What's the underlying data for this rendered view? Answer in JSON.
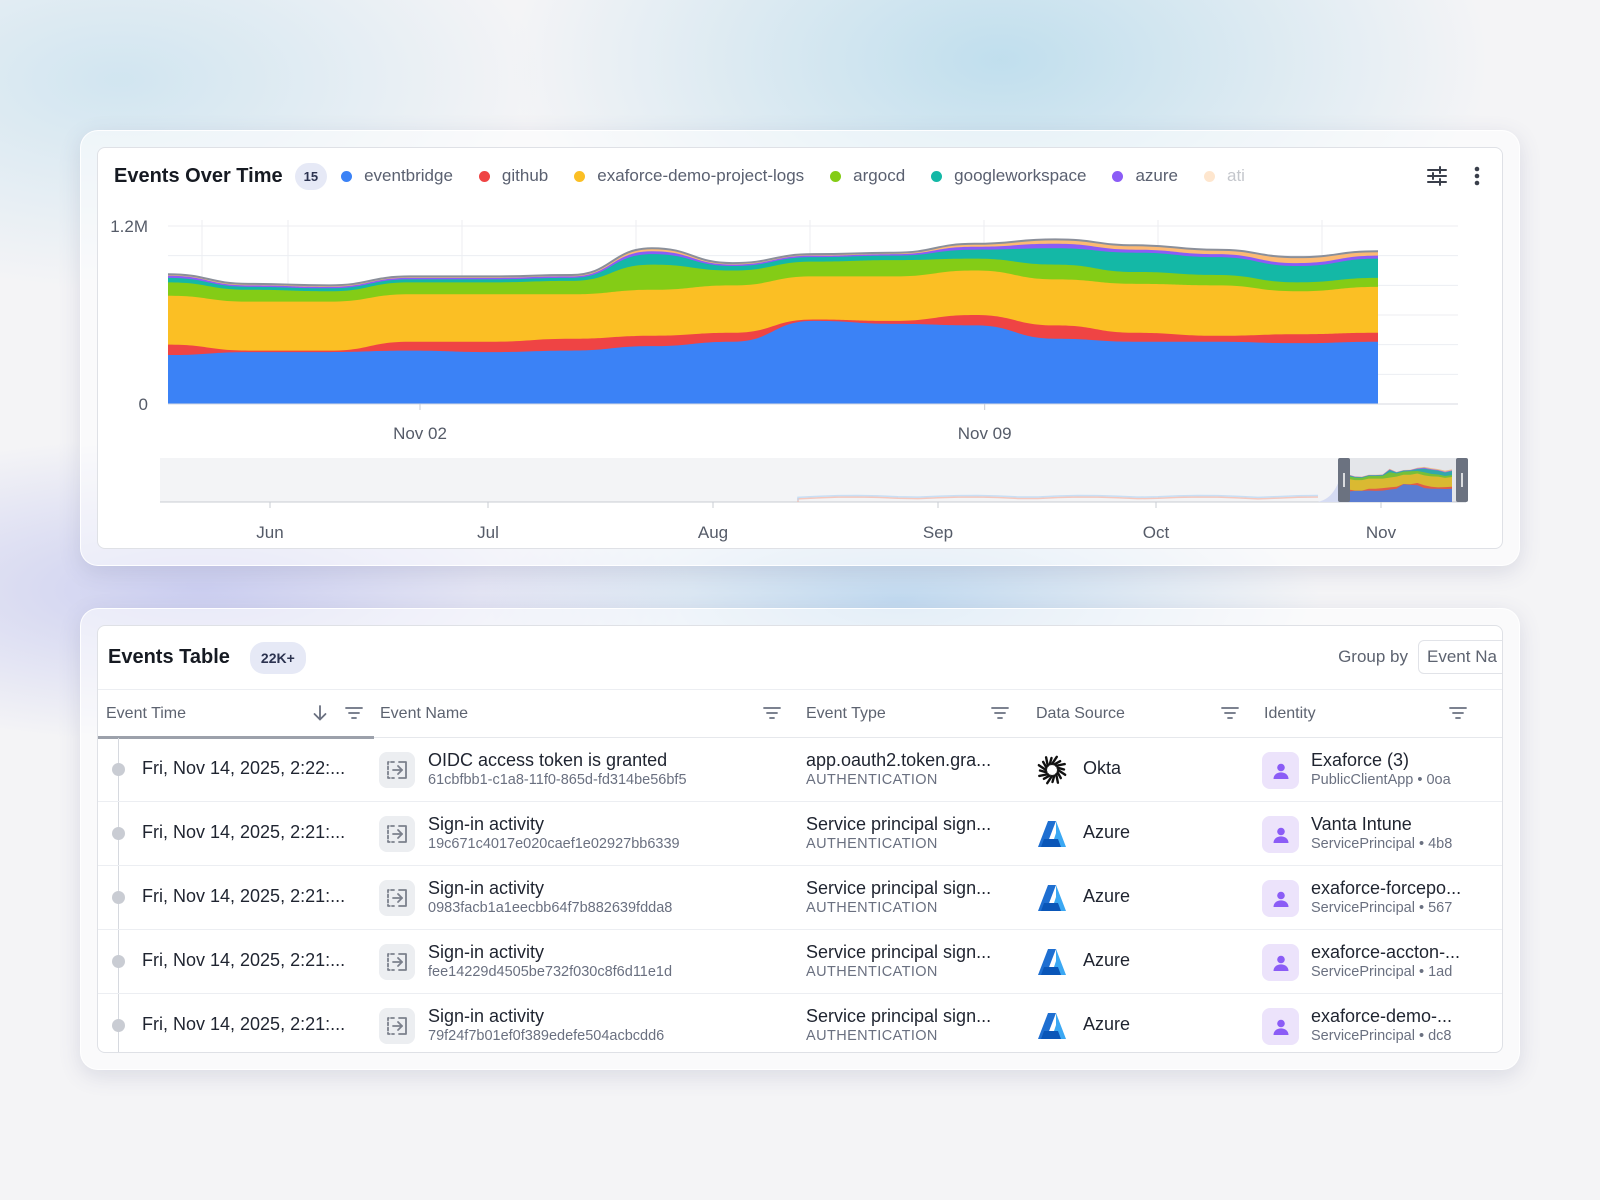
{
  "chart_card": {
    "title": "Events Over Time",
    "count_badge": "15",
    "legend": [
      {
        "label": "eventbridge",
        "color": "#3b82f6"
      },
      {
        "label": "github",
        "color": "#ef4444"
      },
      {
        "label": "exaforce-demo-project-logs",
        "color": "#fbbf24"
      },
      {
        "label": "argocd",
        "color": "#84cc16"
      },
      {
        "label": "googleworkspace",
        "color": "#14b8a6"
      },
      {
        "label": "azure",
        "color": "#8b5cf6"
      },
      {
        "label": "ati",
        "color": "#fdba74"
      }
    ],
    "icons": {
      "settings": "sliders-icon",
      "menu": "more-vertical-icon"
    }
  },
  "chart_data": [
    {
      "type": "area",
      "stacked": true,
      "title": "",
      "ylim": [
        0,
        1200000
      ],
      "y_tick_labels": [
        "0",
        "1.2M"
      ],
      "x_tick_labels": [
        "Nov 02",
        "Nov 09"
      ],
      "x": [
        "Oct 30",
        "Oct 31",
        "Nov 01",
        "Nov 02",
        "Nov 03",
        "Nov 04",
        "Nov 05",
        "Nov 06",
        "Nov 07",
        "Nov 08",
        "Nov 09",
        "Nov 10",
        "Nov 11",
        "Nov 12",
        "Nov 13",
        "Nov 14"
      ],
      "series": [
        {
          "name": "eventbridge",
          "color": "#3b82f6",
          "values": [
            330000,
            350000,
            350000,
            360000,
            350000,
            360000,
            390000,
            420000,
            560000,
            540000,
            530000,
            440000,
            420000,
            420000,
            410000,
            420000
          ]
        },
        {
          "name": "github",
          "color": "#ef4444",
          "values": [
            70000,
            10000,
            10000,
            60000,
            70000,
            80000,
            70000,
            60000,
            10000,
            20000,
            70000,
            90000,
            60000,
            40000,
            60000,
            60000
          ]
        },
        {
          "name": "exaforce-demo-project-logs",
          "color": "#fbbf24",
          "values": [
            330000,
            330000,
            330000,
            320000,
            320000,
            300000,
            310000,
            320000,
            290000,
            300000,
            300000,
            310000,
            330000,
            340000,
            290000,
            310000
          ]
        },
        {
          "name": "argocd",
          "color": "#84cc16",
          "values": [
            90000,
            80000,
            70000,
            80000,
            80000,
            90000,
            170000,
            100000,
            100000,
            110000,
            80000,
            100000,
            80000,
            70000,
            60000,
            60000
          ]
        },
        {
          "name": "googleworkspace",
          "color": "#14b8a6",
          "values": [
            30000,
            20000,
            20000,
            20000,
            20000,
            20000,
            70000,
            30000,
            30000,
            30000,
            60000,
            110000,
            130000,
            120000,
            110000,
            130000
          ]
        },
        {
          "name": "azure",
          "color": "#8b5cf6",
          "values": [
            15000,
            10000,
            10000,
            10000,
            10000,
            10000,
            20000,
            10000,
            10000,
            10000,
            20000,
            30000,
            20000,
            20000,
            20000,
            20000
          ]
        },
        {
          "name": "ati",
          "color": "#fdba74",
          "values": [
            10000,
            10000,
            10000,
            10000,
            10000,
            10000,
            20000,
            10000,
            10000,
            10000,
            20000,
            30000,
            30000,
            30000,
            40000,
            30000
          ]
        }
      ]
    },
    {
      "type": "area",
      "role": "overview-navigator",
      "x_tick_labels": [
        "Jun",
        "Jul",
        "Aug",
        "Sep",
        "Oct",
        "Nov"
      ],
      "selected_range": [
        "Oct 30",
        "Nov 14"
      ]
    }
  ],
  "table_card": {
    "title": "Events Table",
    "count_badge": "22K+",
    "group_by_label": "Group by",
    "group_by_value": "Event Na",
    "columns": {
      "event_time": "Event Time",
      "event_name": "Event Name",
      "event_type": "Event Type",
      "data_source": "Data Source",
      "identity": "Identity"
    },
    "rows": [
      {
        "time": "Fri, Nov 14, 2025, 2:22:...",
        "name": "OIDC access token is granted",
        "id": "61cbfbb1-c1a8-11f0-865d-fd314be56bf5",
        "type": "app.oauth2.token.gra...",
        "type_category": "AUTHENTICATION",
        "source": "Okta",
        "source_icon": "okta-icon",
        "identity": "Exaforce (3)",
        "identity_sub": "PublicClientApp  •  0oa"
      },
      {
        "time": "Fri, Nov 14, 2025, 2:21:...",
        "name": "Sign-in activity",
        "id": "19c671c4017e020caef1e02927bb6339",
        "type": "Service principal sign...",
        "type_category": "AUTHENTICATION",
        "source": "Azure",
        "source_icon": "azure-icon",
        "identity": "Vanta Intune",
        "identity_sub": "ServicePrincipal  •  4b8"
      },
      {
        "time": "Fri, Nov 14, 2025, 2:21:...",
        "name": "Sign-in activity",
        "id": "0983facb1a1eecbb64f7b882639fdda8",
        "type": "Service principal sign...",
        "type_category": "AUTHENTICATION",
        "source": "Azure",
        "source_icon": "azure-icon",
        "identity": "exaforce-forcepo...",
        "identity_sub": "ServicePrincipal  •  567"
      },
      {
        "time": "Fri, Nov 14, 2025, 2:21:...",
        "name": "Sign-in activity",
        "id": "fee14229d4505be732f030c8f6d11e1d",
        "type": "Service principal sign...",
        "type_category": "AUTHENTICATION",
        "source": "Azure",
        "source_icon": "azure-icon",
        "identity": "exaforce-accton-...",
        "identity_sub": "ServicePrincipal  •  1ad"
      },
      {
        "time": "Fri, Nov 14, 2025, 2:21:...",
        "name": "Sign-in activity",
        "id": "79f24f7b01ef0f389edefe504acbcdd6",
        "type": "Service principal sign...",
        "type_category": "AUTHENTICATION",
        "source": "Azure",
        "source_icon": "azure-icon",
        "identity": "exaforce-demo-...",
        "identity_sub": "ServicePrincipal  •  dc8"
      }
    ]
  }
}
